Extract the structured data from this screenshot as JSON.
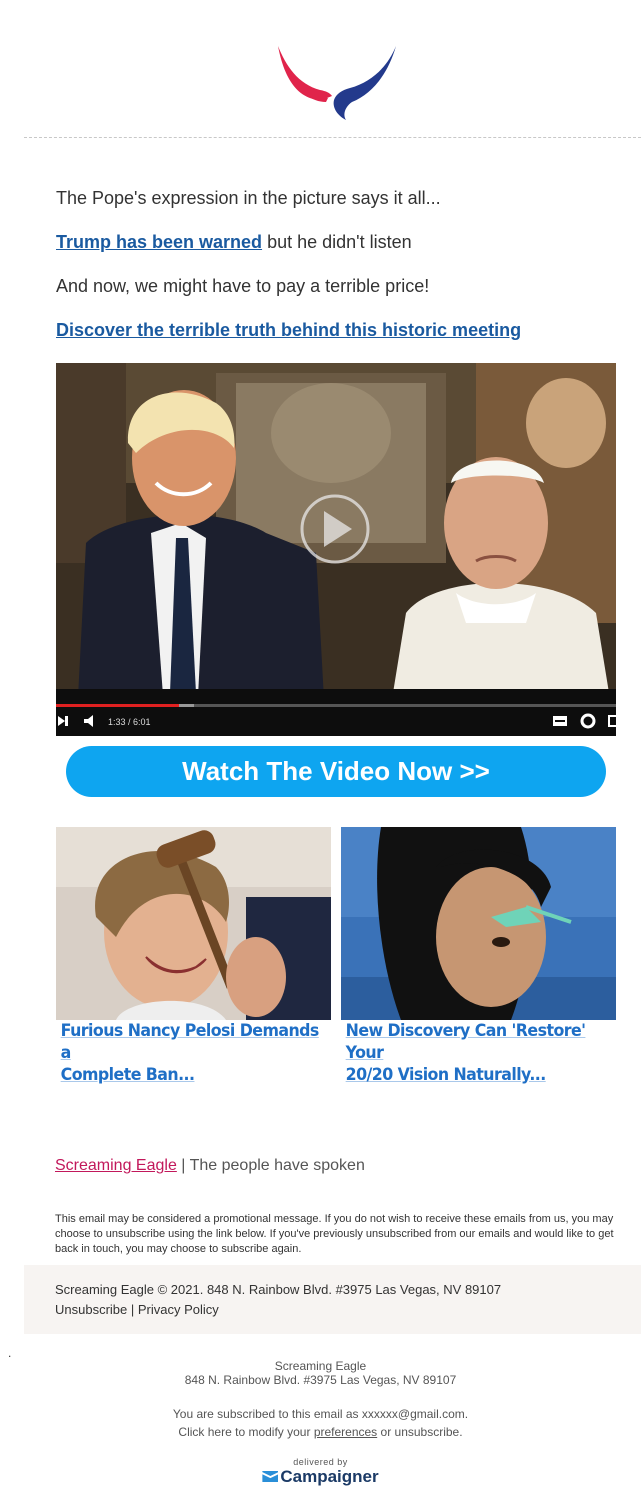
{
  "colors": {
    "link": "#1a5aa0",
    "cta": "#0ea5f0",
    "brand_link": "#c2185b",
    "logo_red": "#e0244b",
    "logo_blue": "#233a8c",
    "caption": "#1f6fc6",
    "footer_bg": "#f7f4f2"
  },
  "header": {
    "logo_icon": "eagle-logo-icon"
  },
  "body": {
    "line1": "The Pope's expression in the picture says it all...",
    "line2_link": "Trump has been warned",
    "line2_rest": " but he didn't listen",
    "line3": "And now, we might have to pay a terrible price!",
    "line4_link": "Discover the terrible truth behind this historic meeting"
  },
  "video": {
    "time": "1:33 / 6:01",
    "progress": 0.22,
    "icons": [
      "play-icon",
      "next-icon",
      "volume-icon",
      "captions-icon",
      "settings-icon",
      "fullscreen-icon"
    ]
  },
  "cta": {
    "label": "Watch The Video Now >>"
  },
  "cards": [
    {
      "caption_line1": "Furious Nancy Pelosi Demands a",
      "caption_line2": "Complete Ban..."
    },
    {
      "caption_line1": "New Discovery Can 'Restore' Your",
      "caption_line2": "20/20 Vision Naturally..."
    }
  ],
  "footer": {
    "brand_link": "Screaming Eagle",
    "tagline": " | The people have spoken",
    "disclaimer": "This email may be considered a promotional message. If you do not wish to receive these emails from us, you may choose to unsubscribe using the link below. If you've previously unsubscribed from our emails and would like to get back in touch, you may choose to subscribe again.",
    "copyright": "Screaming Eagle © 2021. 848 N. Rainbow Blvd. #3975 Las Vegas, NV 89107",
    "unsubscribe": "Unsubscribe",
    "separator": " | ",
    "privacy": "Privacy Policy",
    "dot": ".",
    "sender_name": "Screaming Eagle",
    "sender_address": "848 N. Rainbow Blvd. #3975 Las Vegas, NV 89107",
    "subscribed_text": "You are subscribed to this email as xxxxxx@gmail.com.",
    "modify_prefix": "Click here to modify your ",
    "preferences": "preferences",
    "modify_suffix": " or unsubscribe.",
    "delivered_by": "delivered by",
    "campaigner": "Campaigner"
  }
}
